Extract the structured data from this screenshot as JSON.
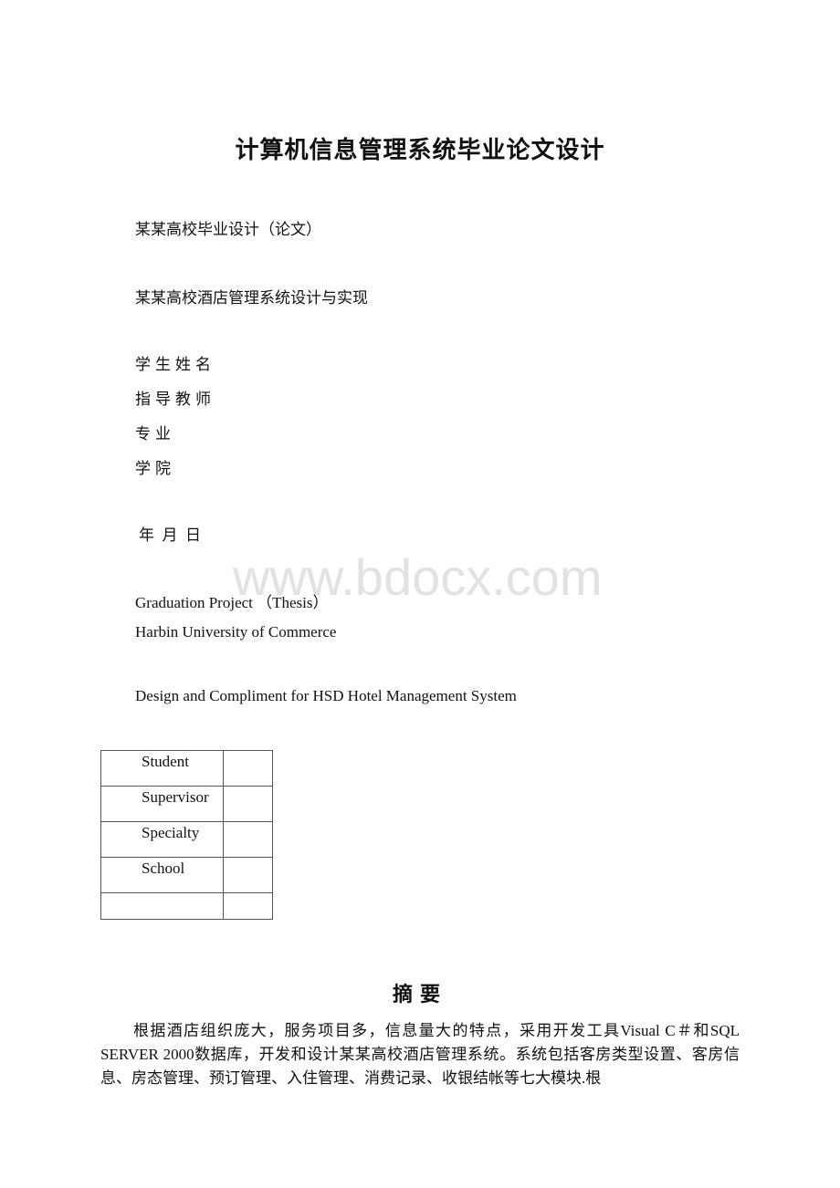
{
  "document": {
    "title": "计算机信息管理系统毕业论文设计",
    "cover": {
      "school_thesis_label": "某某高校毕业设计（论文）",
      "thesis_title_cn": "某某高校酒店管理系统设计与实现",
      "fields": [
        {
          "label": "学生姓名"
        },
        {
          "label": "指导教师"
        },
        {
          "label": "专业"
        },
        {
          "label": "学院"
        }
      ],
      "date_line": "年  月  日",
      "thesis_label_en": "Graduation Project （Thesis）",
      "university_en": "Harbin University of Commerce",
      "thesis_title_en": "Design and Compliment for HSD Hotel Management System"
    },
    "info_table": {
      "rows": [
        {
          "label": "Student",
          "value": ""
        },
        {
          "label": "Supervisor",
          "value": ""
        },
        {
          "label": "Specialty",
          "value": ""
        },
        {
          "label": "School",
          "value": ""
        },
        {
          "label": "",
          "value": ""
        }
      ]
    },
    "watermark": "www.bdocx.com",
    "abstract": {
      "heading": "摘要",
      "text": "根据酒店组织庞大，服务项目多，信息量大的特点，采用开发工具Visual C＃和SQL SERVER 2000数据库，开发和设计某某高校酒店管理系统。系统包括客房类型设置、客房信息、房态管理、预订管理、入住管理、消费记录、收银结帐等七大模块.根"
    }
  }
}
